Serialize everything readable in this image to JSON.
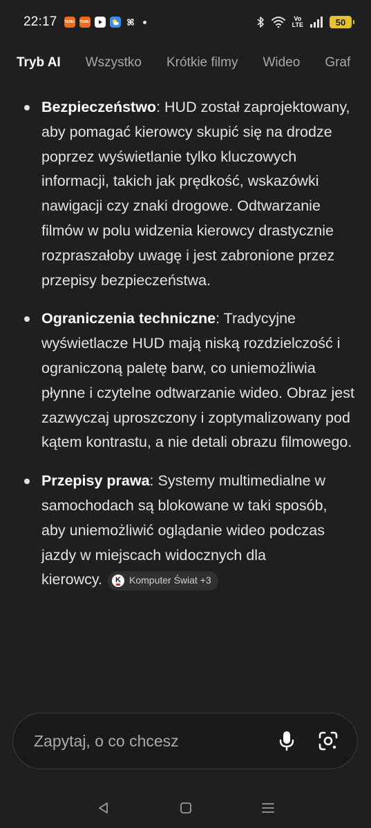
{
  "status_bar": {
    "time": "22:17",
    "notification_icons": [
      "temu-icon",
      "temu-icon",
      "youtube-icon",
      "weather-icon",
      "pinwheel-icon"
    ],
    "temu_label": "TEMU",
    "volte_top": "Vo",
    "volte_bottom": "LTE",
    "battery": "50"
  },
  "tabs": [
    {
      "label": "Tryb AI",
      "active": true
    },
    {
      "label": "Wszystko",
      "active": false
    },
    {
      "label": "Krótkie filmy",
      "active": false
    },
    {
      "label": "Wideo",
      "active": false
    },
    {
      "label": "Graf",
      "active": false
    }
  ],
  "bullets": [
    {
      "title": "Bezpieczeństwo",
      "text": ": HUD został zaprojektowany, aby pomagać kierowcy skupić się na drodze poprzez wyświetlanie tylko kluczowych informacji, takich jak prędkość, wskazówki nawigacji czy znaki drogowe. Odtwarzanie filmów w polu widzenia kierowcy drastycznie rozpraszałoby uwagę i jest zabronione przez przepisy bezpieczeństwa."
    },
    {
      "title": "Ograniczenia techniczne",
      "text": ": Tradycyjne wyświetlacze HUD mają niską rozdzielczość i ograniczoną paletę barw, co uniemożliwia płynne i czytelne odtwarzanie wideo. Obraz jest zazwyczaj uproszczony i zoptymalizowany pod kątem kontrastu, a nie detali obrazu filmowego."
    },
    {
      "title": "Przepisy prawa",
      "text": ": Systemy multimedialne w samochodach są blokowane w taki sposób, aby uniemożliwić oglądanie wideo podczas jazdy w miejscach widocznych dla",
      "text_tail": "kierowcy.",
      "source": {
        "logo_letter": "K",
        "label": "Komputer Świat +3"
      }
    }
  ],
  "search": {
    "placeholder": "Zapytaj, o co chcesz"
  },
  "colors": {
    "background": "#1f1f1f",
    "text": "#e3e3e3",
    "battery": "#e7c230",
    "temu": "#f26b1d"
  }
}
